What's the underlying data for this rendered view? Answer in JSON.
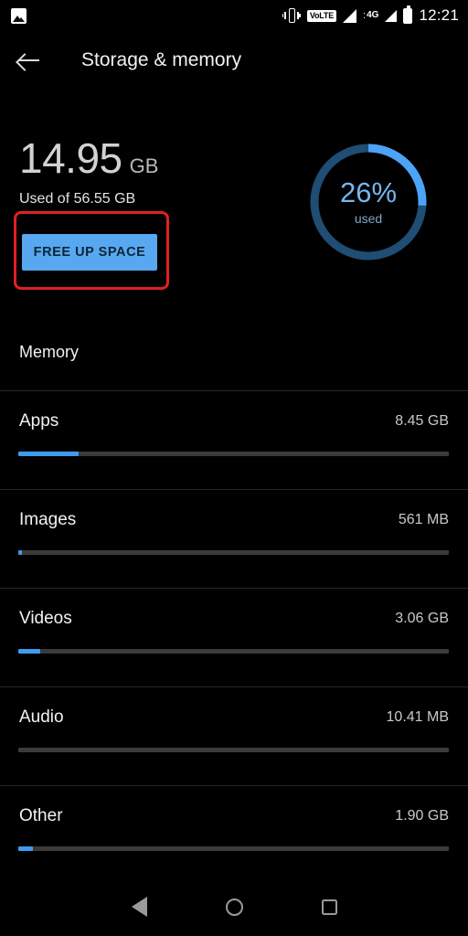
{
  "status_bar": {
    "notification_icon": "photo-icon",
    "vibrate_icon": "vibrate-icon",
    "volte_label": "VoLTE",
    "network_label": "4G",
    "network_dots": ":",
    "battery_icon": "battery-icon",
    "time": "12:21"
  },
  "toolbar": {
    "back_icon": "back-arrow-icon",
    "title": "Storage & memory"
  },
  "summary": {
    "used_amount": "14.95",
    "used_unit": "GB",
    "used_of": "Used of 56.55 GB",
    "free_button": "FREE UP SPACE",
    "ring": {
      "percent_label": "26%",
      "sub_label": "used",
      "percent_value": 26,
      "arc_color": "#4da3f5",
      "track_color": "#1f4d73"
    },
    "highlight_color": "#e02020"
  },
  "section": {
    "title": "Memory"
  },
  "rows": [
    {
      "label": "Apps",
      "value": "8.45 GB",
      "fill_percent": 14.0
    },
    {
      "label": "Images",
      "value": "561 MB",
      "fill_percent": 0.9
    },
    {
      "label": "Videos",
      "value": "3.06 GB",
      "fill_percent": 5.1
    },
    {
      "label": "Audio",
      "value": "10.41 MB",
      "fill_percent": 0.0
    },
    {
      "label": "Other",
      "value": "1.90 GB",
      "fill_percent": 3.4
    }
  ],
  "nav_bar": {
    "back": "nav-back-icon",
    "home": "nav-home-icon",
    "recents": "nav-recents-icon"
  }
}
